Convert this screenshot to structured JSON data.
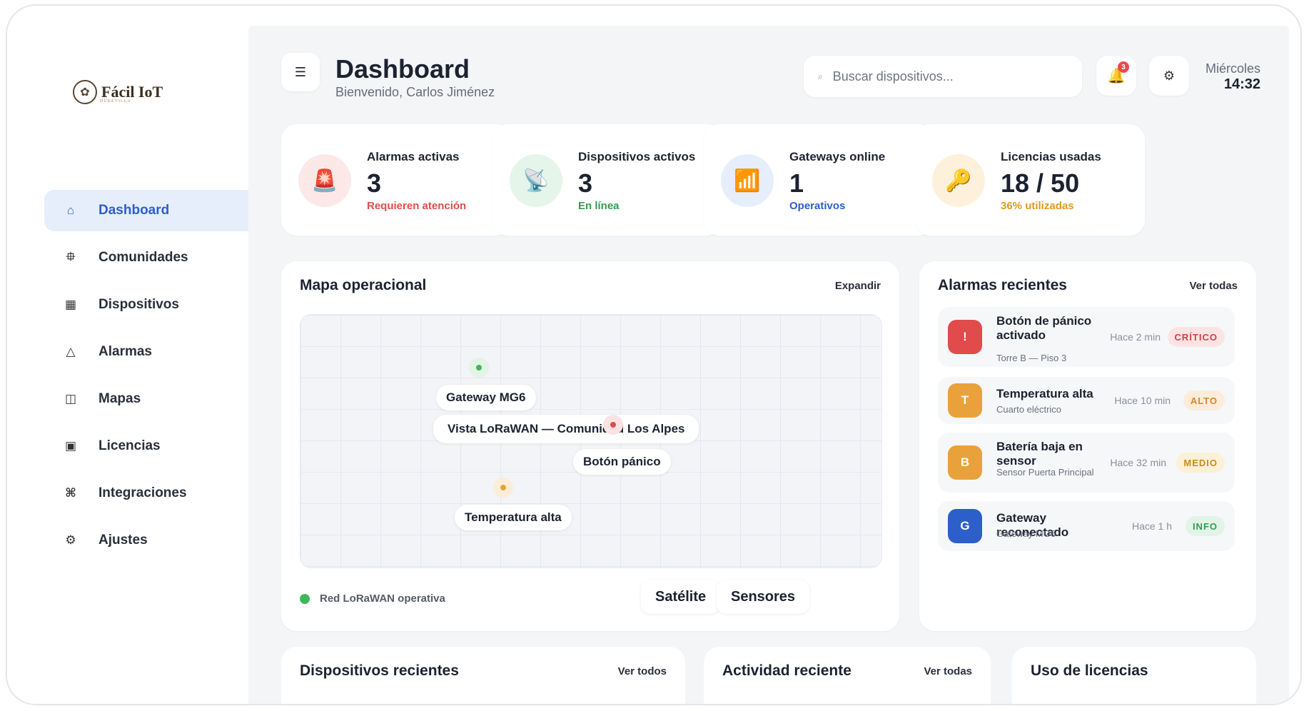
{
  "brand": {
    "name": "Fácil IoT",
    "tagline": "DUKEVILLA",
    "logo_icon": "logo-icon"
  },
  "sidebar": {
    "items": [
      {
        "label": "Dashboard",
        "icon": "home-icon",
        "glyph": "⌂",
        "active": true
      },
      {
        "label": "Comunidades",
        "icon": "community-icon",
        "glyph": "⯐"
      },
      {
        "label": "Dispositivos",
        "icon": "grid-icon",
        "glyph": "▦"
      },
      {
        "label": "Alarmas",
        "icon": "warning-icon",
        "glyph": "△"
      },
      {
        "label": "Mapas",
        "icon": "map-icon",
        "glyph": "◫"
      },
      {
        "label": "Licencias",
        "icon": "license-icon",
        "glyph": "▣"
      },
      {
        "label": "Integraciones",
        "icon": "command-icon",
        "glyph": "⌘"
      },
      {
        "label": "Ajustes",
        "icon": "gear-icon",
        "glyph": "⚙"
      }
    ]
  },
  "header": {
    "title": "Dashboard",
    "subtitle": "Bienvenido, Carlos Jiménez",
    "search_placeholder": "Buscar dispositivos...",
    "notifications_count": "3",
    "day": "Miércoles",
    "time": "14:32"
  },
  "stats": [
    {
      "label": "Alarmas activas",
      "value": "3",
      "note": "Requieren atención",
      "note_color": "#e14b4b",
      "circle_bg": "#fde8e8",
      "icon": "siren-icon",
      "glyph": "🚨"
    },
    {
      "label": "Dispositivos activos",
      "value": "3",
      "note": "En línea",
      "note_color": "#2f9e4f",
      "circle_bg": "#e5f5ea",
      "icon": "satellite-icon",
      "glyph": "📡"
    },
    {
      "label": "Gateways online",
      "value": "1",
      "note": "Operativos",
      "note_color": "#2c5fc9",
      "circle_bg": "#e6eefc",
      "icon": "signal-chart-icon",
      "glyph": "📶"
    },
    {
      "label": "Licencias usadas",
      "value": "18 / 50",
      "note": "36% utilizadas",
      "note_color": "#e09a1c",
      "circle_bg": "#fdf1dc",
      "icon": "key-icon",
      "glyph": "🔑"
    }
  ],
  "map": {
    "title": "Mapa operacional",
    "expand": "Expandir",
    "center_label": "Vista LoRaWAN — Comunidad Los Alpes",
    "pins": [
      {
        "label": "Gateway MG6",
        "color": "#3fb85a",
        "ring": "#e3f3e6"
      },
      {
        "label": "Botón pánico",
        "color": "#e14b4b",
        "ring": "#fbe3e3"
      },
      {
        "label": "Temperatura alta",
        "color": "#e9a23b",
        "ring": "#fbeed9"
      }
    ],
    "status": "Red LoRaWAN operativa",
    "status_color": "#3fb85a",
    "toggles": [
      "Satélite",
      "Sensores"
    ]
  },
  "alarms": {
    "title": "Alarmas recientes",
    "link": "Ver todas",
    "items": [
      {
        "initial": "!",
        "color": "#e14b4b",
        "title": "Botón de pánico activado",
        "subtitle": "Torre B — Piso 3",
        "time": "Hace 2 min",
        "tag": "CRÍTICO",
        "tag_color": "#d24242",
        "tag_bg": "#fde4e4"
      },
      {
        "initial": "T",
        "color": "#e9a23b",
        "title": "Temperatura alta",
        "subtitle": "Cuarto eléctrico",
        "time": "Hace 10 min",
        "tag": "ALTO",
        "tag_color": "#d9862a",
        "tag_bg": "#fcecd9"
      },
      {
        "initial": "B",
        "color": "#e9a23b",
        "title": "Batería baja en sensor",
        "subtitle": "Sensor Puerta Principal",
        "time": "Hace 32 min",
        "tag": "MEDIO",
        "tag_color": "#c88d1c",
        "tag_bg": "#fcf0d6"
      },
      {
        "initial": "G",
        "color": "#2c5fc9",
        "title": "Gateway reconectado",
        "subtitle": "Gateway MG6",
        "time": "Hace 1 h",
        "tag": "INFO",
        "tag_color": "#2f9e4f",
        "tag_bg": "#e2f4e7"
      }
    ]
  },
  "bottom": {
    "devices": {
      "title": "Dispositivos recientes",
      "link": "Ver todos"
    },
    "activity": {
      "title": "Actividad reciente",
      "link": "Ver todas"
    },
    "licenses": {
      "title": "Uso de licencias"
    }
  }
}
